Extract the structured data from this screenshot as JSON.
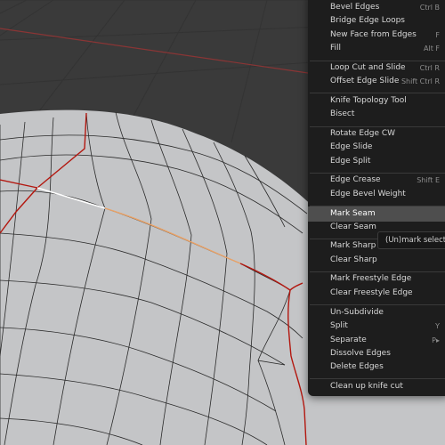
{
  "viewport": {
    "background": "#3a3a3a",
    "mesh_color": "#c4c5c7",
    "seam_color": "#b3170f",
    "selected_edge_color": "#ffffff",
    "active_edge_color": "#e9a267"
  },
  "menu": {
    "items": [
      {
        "label": "Bevel Edges",
        "shortcut": "Ctrl B"
      },
      {
        "label": "Bridge Edge Loops",
        "shortcut": ""
      },
      {
        "label": "New Face from Edges",
        "shortcut": "F"
      },
      {
        "label": "Fill",
        "shortcut": "Alt F"
      },
      {
        "label": "Loop Cut and Slide",
        "shortcut": "Ctrl R"
      },
      {
        "label": "Offset Edge Slide",
        "shortcut": "Shift Ctrl R"
      },
      {
        "label": "Knife Topology Tool",
        "shortcut": ""
      },
      {
        "label": "Bisect",
        "shortcut": ""
      },
      {
        "label": "Rotate Edge CW",
        "shortcut": ""
      },
      {
        "label": "Edge Slide",
        "shortcut": ""
      },
      {
        "label": "Edge Split",
        "shortcut": ""
      },
      {
        "label": "Edge Crease",
        "shortcut": "Shift E"
      },
      {
        "label": "Edge Bevel Weight",
        "shortcut": ""
      },
      {
        "label": "Mark Seam",
        "shortcut": ""
      },
      {
        "label": "Clear Seam",
        "shortcut": ""
      },
      {
        "label": "Mark Sharp",
        "shortcut": ""
      },
      {
        "label": "Clear Sharp",
        "shortcut": ""
      },
      {
        "label": "Mark Freestyle Edge",
        "shortcut": ""
      },
      {
        "label": "Clear Freestyle Edge",
        "shortcut": ""
      },
      {
        "label": "Un-Subdivide",
        "shortcut": ""
      },
      {
        "label": "Split",
        "shortcut": "Y"
      },
      {
        "label": "Separate",
        "shortcut": "P▸"
      },
      {
        "label": "Dissolve Edges",
        "shortcut": ""
      },
      {
        "label": "Delete Edges",
        "shortcut": ""
      },
      {
        "label": "Clean up knife cut",
        "shortcut": ""
      }
    ],
    "highlighted": "Mark Seam"
  },
  "tooltip": {
    "text": "(Un)mark selected"
  }
}
